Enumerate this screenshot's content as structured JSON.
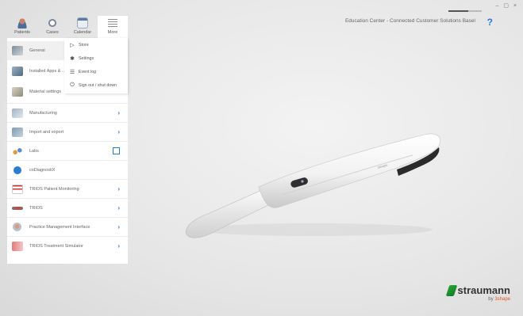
{
  "window": {
    "controls": "– ▢ ×",
    "header_info": "Education Center - Connected Customer Solutions Basel",
    "help": "?",
    "progress": 0.6
  },
  "topnav": [
    {
      "label": "Patients",
      "icon": "patients-icon"
    },
    {
      "label": "Cases",
      "icon": "cases-icon"
    },
    {
      "label": "Calendar",
      "icon": "calendar-icon"
    },
    {
      "label": "More",
      "icon": "more-icon"
    }
  ],
  "sidebar": {
    "items": [
      {
        "label": "General",
        "icon": "general-icon"
      },
      {
        "label": "Installed Apps & ...",
        "icon": "apps-icon"
      },
      {
        "label": "Material settings",
        "icon": "material-icon"
      },
      {
        "label": "Manufacturing",
        "icon": "manufacturing-icon"
      },
      {
        "label": "Import and export",
        "icon": "import-export-icon"
      },
      {
        "label": "Labs",
        "icon": "labs-icon"
      },
      {
        "label": "coDiagnostiX",
        "icon": "codiagnostix-icon"
      },
      {
        "label": "TRIOS Patient Monitoring",
        "icon": "trios-patient-monitoring-icon"
      },
      {
        "label": "TRIOS",
        "icon": "trios-icon"
      },
      {
        "label": "Practice Management Interface",
        "icon": "practice-management-icon"
      },
      {
        "label": "TRIOS Treatment Simulator",
        "icon": "treatment-simulator-icon"
      }
    ]
  },
  "submenu": {
    "items": [
      {
        "label": "Store",
        "icon": "store-icon"
      },
      {
        "label": "Settings",
        "icon": "gear-icon"
      },
      {
        "label": "Event log",
        "icon": "event-log-icon"
      },
      {
        "label": "Sign out / shut down",
        "icon": "power-icon"
      }
    ]
  },
  "scanner_brand": "3shape",
  "logo": {
    "name": "straumann",
    "sub_prefix": "by ",
    "sub_brand": "3shape"
  },
  "colors": {
    "accent": "#2a7bd1",
    "logo_green": "#1e9632",
    "logo_orange": "#e2571c"
  }
}
